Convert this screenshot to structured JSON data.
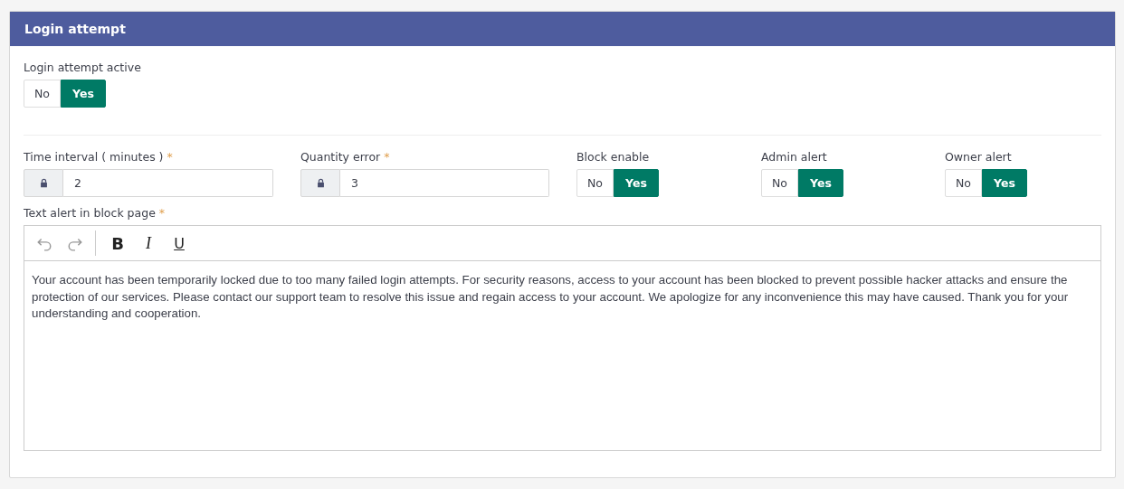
{
  "panel": {
    "title": "Login attempt"
  },
  "active": {
    "label": "Login attempt active",
    "options": [
      {
        "label": "No",
        "selected": false
      },
      {
        "label": "Yes",
        "selected": true
      }
    ]
  },
  "fields": [
    {
      "kind": "input",
      "label": "Time interval ( minutes )",
      "required_mark": "*",
      "value": "2"
    },
    {
      "kind": "input",
      "label": "Quantity error",
      "required_mark": "*",
      "value": "3"
    },
    {
      "kind": "toggle",
      "label": "Block enable",
      "options": [
        {
          "label": "No",
          "selected": false
        },
        {
          "label": "Yes",
          "selected": true
        }
      ]
    },
    {
      "kind": "toggle",
      "label": "Admin alert",
      "options": [
        {
          "label": "No",
          "selected": false
        },
        {
          "label": "Yes",
          "selected": true
        }
      ]
    },
    {
      "kind": "toggle",
      "label": "Owner alert",
      "options": [
        {
          "label": "No",
          "selected": false
        },
        {
          "label": "Yes",
          "selected": true
        }
      ]
    }
  ],
  "editor": {
    "label": "Text alert in block page",
    "required_mark": "*",
    "toolbar": [
      {
        "kind": "undo"
      },
      {
        "kind": "redo"
      },
      {
        "kind": "bold",
        "text": "B"
      },
      {
        "kind": "italic",
        "text": "I"
      },
      {
        "kind": "underline",
        "text": "U"
      }
    ],
    "content": "Your account has been temporarily locked due to too many failed login attempts. For security reasons, access to your account has been blocked to prevent possible hacker attacks and ensure the protection of our services. Please contact our support team to resolve this issue and regain access to your account. We apologize for any inconvenience this may have caused. Thank you for your understanding and cooperation."
  }
}
